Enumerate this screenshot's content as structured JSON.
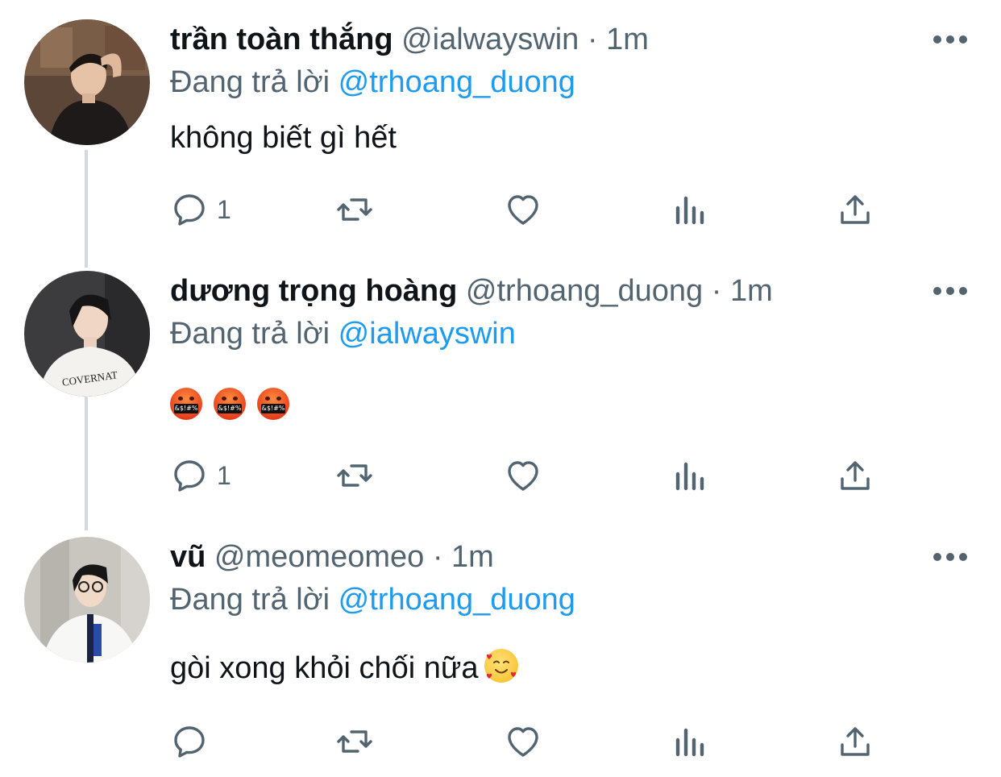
{
  "tweets": [
    {
      "name": "trần toàn thắng",
      "handle": "@ialwayswin",
      "separator": "·",
      "time": "1m",
      "reply_prefix": "Đang trả lời",
      "reply_to": "@trhoang_duong",
      "text": "không biết gì hết",
      "reply_count": "1",
      "avatar": "user-photo-1"
    },
    {
      "name": "dương trọng hoàng",
      "handle": "@trhoang_duong",
      "separator": "·",
      "time": "1m",
      "reply_prefix": "Đang trả lời",
      "reply_to": "@ialwayswin",
      "emoji_symbol_text": "&$!#%",
      "reply_count": "1",
      "avatar": "user-photo-2",
      "shirt_text": "COVERNAT"
    },
    {
      "name": "vũ",
      "handle": "@meomeomeo",
      "separator": "·",
      "time": "1m",
      "reply_prefix": "Đang trả lời",
      "reply_to": "@trhoang_duong",
      "text": "gòi xong khỏi chối nữa",
      "reply_count": "",
      "avatar": "user-photo-3"
    }
  ],
  "icons": {
    "reply": "reply-icon",
    "retweet": "retweet-icon",
    "like": "like-icon",
    "views": "views-icon",
    "share": "share-icon",
    "more": "more-icon"
  },
  "colors": {
    "text": "#0f1419",
    "secondary": "#536471",
    "accent": "#1d9bf0",
    "thread_line": "#cfd9de"
  }
}
